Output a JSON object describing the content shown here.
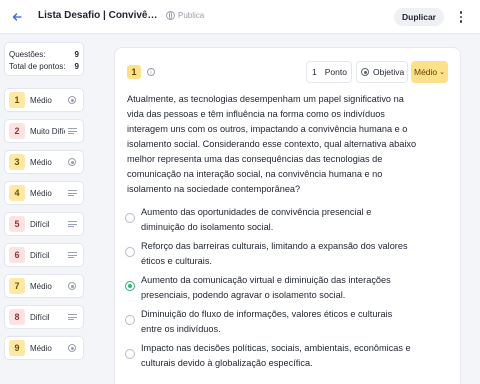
{
  "header": {
    "title": "Lista Desafio | Convivência ...",
    "visibility": "Publica",
    "duplicate_label": "Duplicar"
  },
  "sidebar": {
    "stats": [
      {
        "label": "Questões:",
        "value": "9"
      },
      {
        "label": "Total de pontos:",
        "value": "9"
      }
    ],
    "questions": [
      {
        "number": "1",
        "difficulty": "Médio",
        "type_icon": "radio-icon"
      },
      {
        "number": "2",
        "difficulty": "Muito Difícil",
        "type_icon": "lines-icon"
      },
      {
        "number": "3",
        "difficulty": "Médio",
        "type_icon": "radio-icon"
      },
      {
        "number": "4",
        "difficulty": "Médio",
        "type_icon": "lines-icon"
      },
      {
        "number": "5",
        "difficulty": "Difícil",
        "type_icon": "lines-icon"
      },
      {
        "number": "6",
        "difficulty": "Difícil",
        "type_icon": "lines-icon"
      },
      {
        "number": "7",
        "difficulty": "Médio",
        "type_icon": "radio-icon"
      },
      {
        "number": "8",
        "difficulty": "Difícil",
        "type_icon": "lines-icon"
      },
      {
        "number": "9",
        "difficulty": "Médio",
        "type_icon": "radio-icon"
      }
    ]
  },
  "question": {
    "number": "1",
    "points_value": "1",
    "points_label": "Ponto",
    "type_label": "Objetiva",
    "difficulty": "Médio",
    "text": "Atualmente, as tecnologias desempenham um papel significativo na vida das pessoas e têm influência na forma como os indivíduos interagem uns com os outros, impactando a convivência humana e o isolamento social. Considerando esse contexto, qual alternativa abaixo melhor representa uma das consequências das tecnologias de comunicação na interação social, na convivência humana e no isolamento na sociedade contemporânea?",
    "options": [
      {
        "text": "Aumento das oportunidades de convivência presencial e diminuição do isolamento social.",
        "selected": false
      },
      {
        "text": "Reforço das barreiras culturais, limitando a expansão dos valores éticos e culturais.",
        "selected": false
      },
      {
        "text": "Aumento da comunicação virtual e diminuição das interações presenciais, podendo agravar o isolamento social.",
        "selected": true
      },
      {
        "text": "Diminuição do fluxo de informações, valores éticos e culturais entre os indivíduos.",
        "selected": false
      },
      {
        "text": "Impacto nas decisões políticas, sociais, ambientais, econômicas e culturais devido à globalização específica.",
        "selected": false
      }
    ]
  },
  "colors": {
    "accent": "#3b5bdb",
    "medium_badge": "#ffe8a3",
    "hard_badge": "#fde2e2",
    "selected_option": "#2fb67c"
  }
}
